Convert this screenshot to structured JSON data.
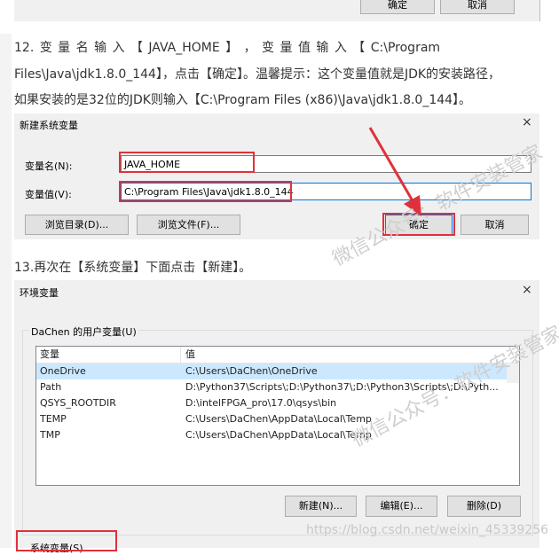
{
  "top_dialog": {
    "ok_label": "确定",
    "cancel_label": "取消"
  },
  "step12": {
    "line1": "12. 变 量 名 输 入 【 JAVA_HOME 】 ， 变 量 值 输 入 【 C:\\Program",
    "line2": "Files\\Java\\jdk1.8.0_144】，点击【确定】。温馨提示：这个变量值就是JDK的安装路径，",
    "line3": "如果安装的是32位的JDK则输入【C:\\Program Files (x86)\\Java\\jdk1.8.0_144】。"
  },
  "new_var_dialog": {
    "title": "新建系统变量",
    "name_label": "变量名(N):",
    "name_value": "JAVA_HOME",
    "value_label": "变量值(V):",
    "value_value": "C:\\Program Files\\Java\\jdk1.8.0_144",
    "browse_dir_label": "浏览目录(D)...",
    "browse_file_label": "浏览文件(F)...",
    "ok_label": "确定",
    "cancel_label": "取消",
    "close": "×"
  },
  "step13": {
    "text": "13.再次在【系统变量】下面点击【新建】。"
  },
  "env_dialog": {
    "title": "环境变量",
    "close": "×",
    "user_group_label": "DaChen 的用户变量(U)",
    "col_var": "变量",
    "col_val": "值",
    "rows": [
      {
        "var": "OneDrive",
        "val": "C:\\Users\\DaChen\\OneDrive"
      },
      {
        "var": "Path",
        "val": "D:\\Python37\\Scripts\\;D:\\Python37\\;D:\\Python3\\Scripts\\;D:\\Pyth..."
      },
      {
        "var": "QSYS_ROOTDIR",
        "val": "D:\\intelFPGA_pro\\17.0\\qsys\\bin"
      },
      {
        "var": "TEMP",
        "val": "C:\\Users\\DaChen\\AppData\\Local\\Temp"
      },
      {
        "var": "TMP",
        "val": "C:\\Users\\DaChen\\AppData\\Local\\Temp"
      }
    ],
    "new_label": "新建(N)...",
    "edit_label": "编辑(E)...",
    "delete_label": "删除(D)",
    "system_group_label": "系统变量(S)"
  },
  "watermarks": {
    "wm1": "微信公众号：软件安装管家",
    "wm2": "微信公众号：软件安装管家",
    "url": "https://blog.csdn.net/weixin_45339256"
  },
  "colors": {
    "highlight_red": "#e0313b",
    "selection_blue": "#cce8ff",
    "focus_blue": "#0078d7"
  }
}
